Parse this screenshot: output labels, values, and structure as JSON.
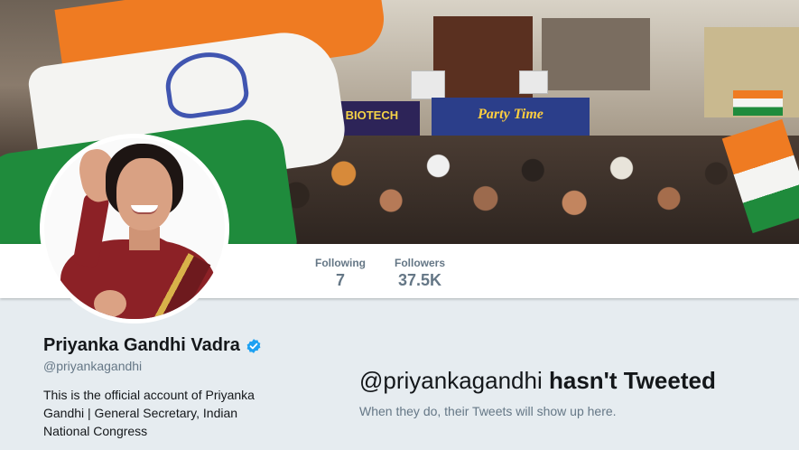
{
  "profile": {
    "name": "Priyanka Gandhi Vadra",
    "handle": "@priyankagandhi",
    "bio": "This is the official account of Priyanka Gandhi | General Secretary, Indian National Congress",
    "verified": true
  },
  "stats": {
    "following_label": "Following",
    "following_value": "7",
    "followers_label": "Followers",
    "followers_value": "37.5K"
  },
  "banner": {
    "sign_left": "HI BIOTECH",
    "sign_right": "Party Time"
  },
  "empty_state": {
    "handle": "@priyankagandhi",
    "title_suffix": "hasn't Tweeted",
    "subtitle": "When they do, their Tweets will show up here."
  },
  "colors": {
    "accent": "#1da1f2",
    "background": "#e6ecf0",
    "text_primary": "#14171a",
    "text_secondary": "#657786"
  }
}
